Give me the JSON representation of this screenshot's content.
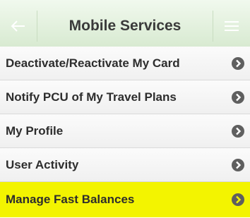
{
  "header": {
    "title": "Mobile Services",
    "back_icon": "back-arrow-icon",
    "menu_icon": "hamburger-menu-icon"
  },
  "menu": {
    "items": [
      {
        "label": "Deactivate/Reactivate My Card",
        "highlighted": false
      },
      {
        "label": "Notify PCU of My Travel Plans",
        "highlighted": false
      },
      {
        "label": "My Profile",
        "highlighted": false
      },
      {
        "label": "User Activity",
        "highlighted": false
      },
      {
        "label": "Manage Fast Balances",
        "highlighted": true
      }
    ],
    "item_icon": "chevron-right-circle-icon"
  },
  "colors": {
    "header_bg": "#d6e9cf",
    "highlight": "#f3f400",
    "arrow": "#5f5f5f"
  }
}
